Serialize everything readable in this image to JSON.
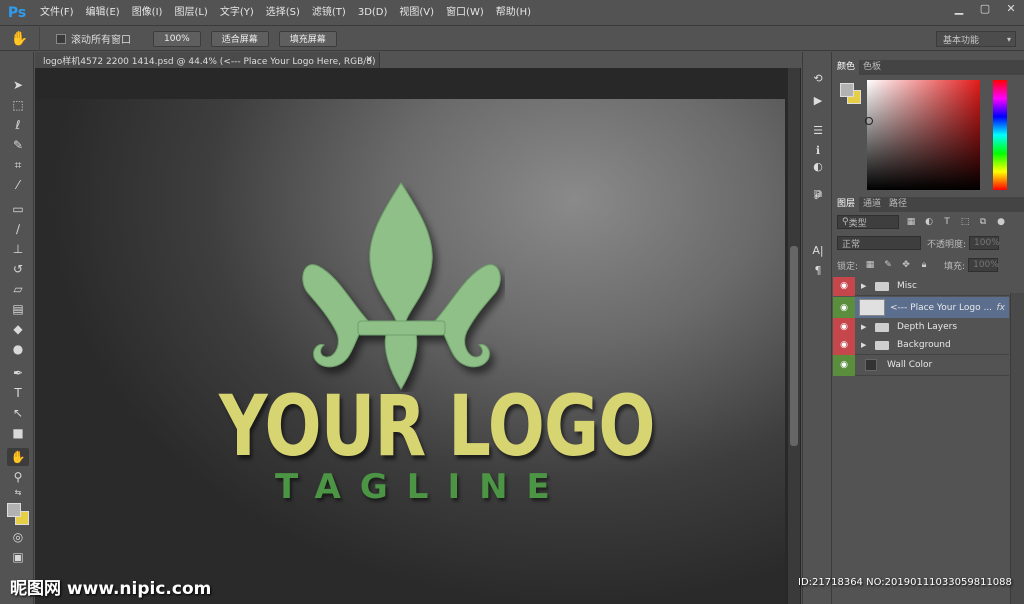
{
  "app": {
    "logo": "Ps"
  },
  "menu": [
    "文件(F)",
    "编辑(E)",
    "图像(I)",
    "图层(L)",
    "文字(Y)",
    "选择(S)",
    "滤镜(T)",
    "3D(D)",
    "视图(V)",
    "窗口(W)",
    "帮助(H)"
  ],
  "options": {
    "scroll_all_label": "滚动所有窗口",
    "zoom_100": "100%",
    "fit_screen": "适合屏幕",
    "fill_screen": "填充屏幕",
    "workspace": "基本功能"
  },
  "document": {
    "tab_title": "logo样机4572 2200 1414.psd @ 44.4% (<--- Place Your Logo Here, RGB/8)",
    "logo_text": "YOUR LOGO",
    "tagline": "TAGLINE"
  },
  "colors": {
    "foreground": "#b2b2b2",
    "background": "#e6cf46",
    "logo_fill": "#8fc088",
    "text_fill": "#d7d472",
    "tagline_fill": "#4c9545"
  },
  "color_panel": {
    "tabs": [
      "颜色",
      "色板"
    ]
  },
  "layers_panel": {
    "tabs": [
      "图层",
      "通道",
      "路径"
    ],
    "filter_kind": "类型",
    "blend_mode": "正常",
    "opacity_label": "不透明度:",
    "opacity_value": "100%",
    "lock_label": "锁定:",
    "fill_label": "填充:",
    "fill_value": "100%",
    "layers": [
      {
        "name": "Misc",
        "type": "group",
        "eye": "red"
      },
      {
        "name": "<--- Place Your Logo ...",
        "type": "smart",
        "eye": "green",
        "fx": "fx"
      },
      {
        "name": "Depth Layers",
        "type": "group",
        "eye": "red"
      },
      {
        "name": "Background",
        "type": "group",
        "eye": "red"
      },
      {
        "name": "Wall Color",
        "type": "fill",
        "eye": "green"
      }
    ]
  },
  "watermark": "昵图网 www.nipic.com",
  "image_id": "ID:21718364 NO:20190111033059811088"
}
